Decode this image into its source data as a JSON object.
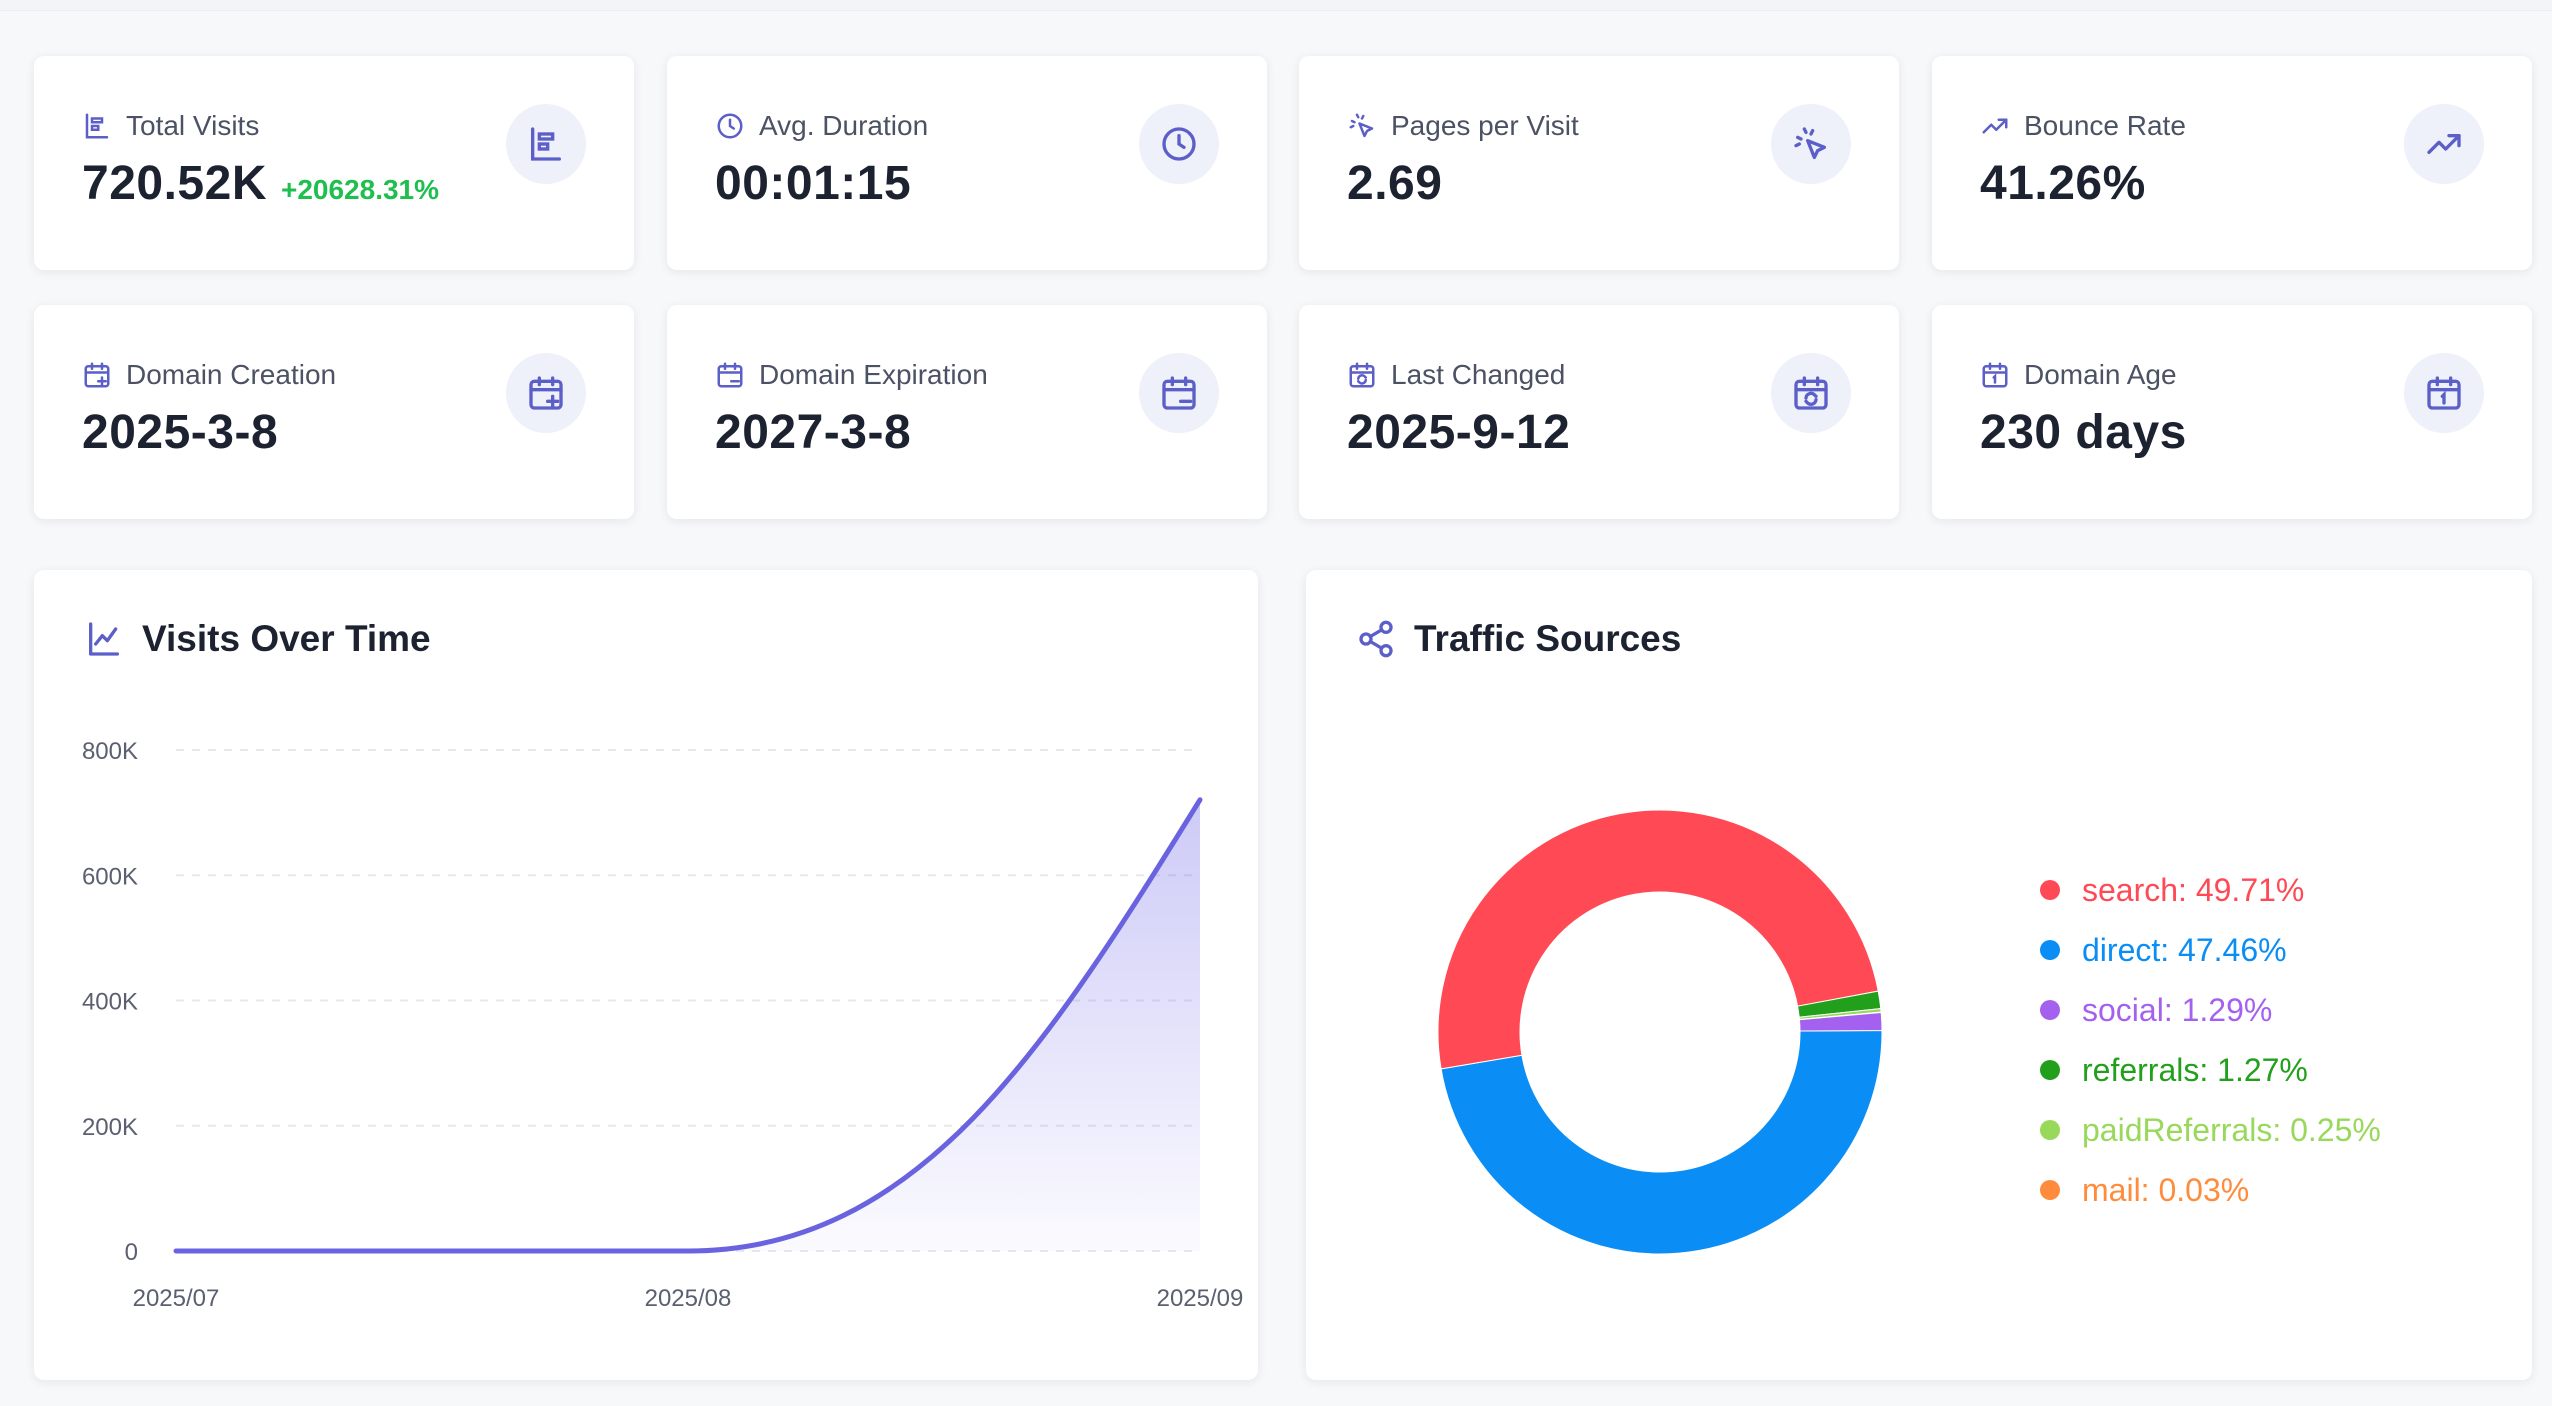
{
  "stats": [
    {
      "label": "Total Visits",
      "value": "720.52K",
      "delta": "+20628.31%",
      "icon": "bar-chart-icon"
    },
    {
      "label": "Avg. Duration",
      "value": "00:01:15",
      "icon": "clock-icon"
    },
    {
      "label": "Pages per Visit",
      "value": "2.69",
      "icon": "cursor-click-icon"
    },
    {
      "label": "Bounce Rate",
      "value": "41.26%",
      "icon": "trending-up-icon"
    },
    {
      "label": "Domain Creation",
      "value": "2025-3-8",
      "icon": "calendar-plus-icon"
    },
    {
      "label": "Domain Expiration",
      "value": "2027-3-8",
      "icon": "calendar-minus-icon"
    },
    {
      "label": "Last Changed",
      "value": "2025-9-12",
      "icon": "calendar-sync-icon"
    },
    {
      "label": "Domain Age",
      "value": "230 days",
      "icon": "calendar-day-icon"
    }
  ],
  "visits_panel": {
    "title": "Visits Over Time",
    "icon": "line-chart-icon"
  },
  "traffic_panel": {
    "title": "Traffic Sources",
    "icon": "share-icon"
  },
  "colors": {
    "accent": "#6a63e0",
    "positive": "#1fbf4f",
    "search": "#ff4a55",
    "direct": "#0a8ef5",
    "social": "#a461f0",
    "referrals": "#22a01c",
    "paidReferrals": "#98d85a",
    "mail": "#ff8c3c"
  },
  "chart_data": [
    {
      "type": "area",
      "title": "Visits Over Time",
      "x": [
        "2025/07",
        "2025/08",
        "2025/09"
      ],
      "values": [
        0,
        0,
        720520
      ],
      "ylim": [
        0,
        800000
      ],
      "yticks": [
        {
          "value": 0,
          "label": "0"
        },
        {
          "value": 200000,
          "label": "200K"
        },
        {
          "value": 400000,
          "label": "400K"
        },
        {
          "value": 600000,
          "label": "600K"
        },
        {
          "value": 800000,
          "label": "800K"
        }
      ],
      "grid": true
    },
    {
      "type": "pie",
      "title": "Traffic Sources",
      "legend": "right",
      "slices": [
        {
          "label": "search",
          "value": 49.71,
          "text": "search: 49.71%",
          "color": "#ff4a55"
        },
        {
          "label": "direct",
          "value": 47.46,
          "text": "direct: 47.46%",
          "color": "#0a8ef5"
        },
        {
          "label": "social",
          "value": 1.29,
          "text": "social: 1.29%",
          "color": "#a461f0"
        },
        {
          "label": "referrals",
          "value": 1.27,
          "text": "referrals: 1.27%",
          "color": "#22a01c"
        },
        {
          "label": "paidReferrals",
          "value": 0.25,
          "text": "paidReferrals: 0.25%",
          "color": "#98d85a"
        },
        {
          "label": "mail",
          "value": 0.03,
          "text": "mail: 0.03%",
          "color": "#ff8c3c"
        }
      ]
    }
  ]
}
